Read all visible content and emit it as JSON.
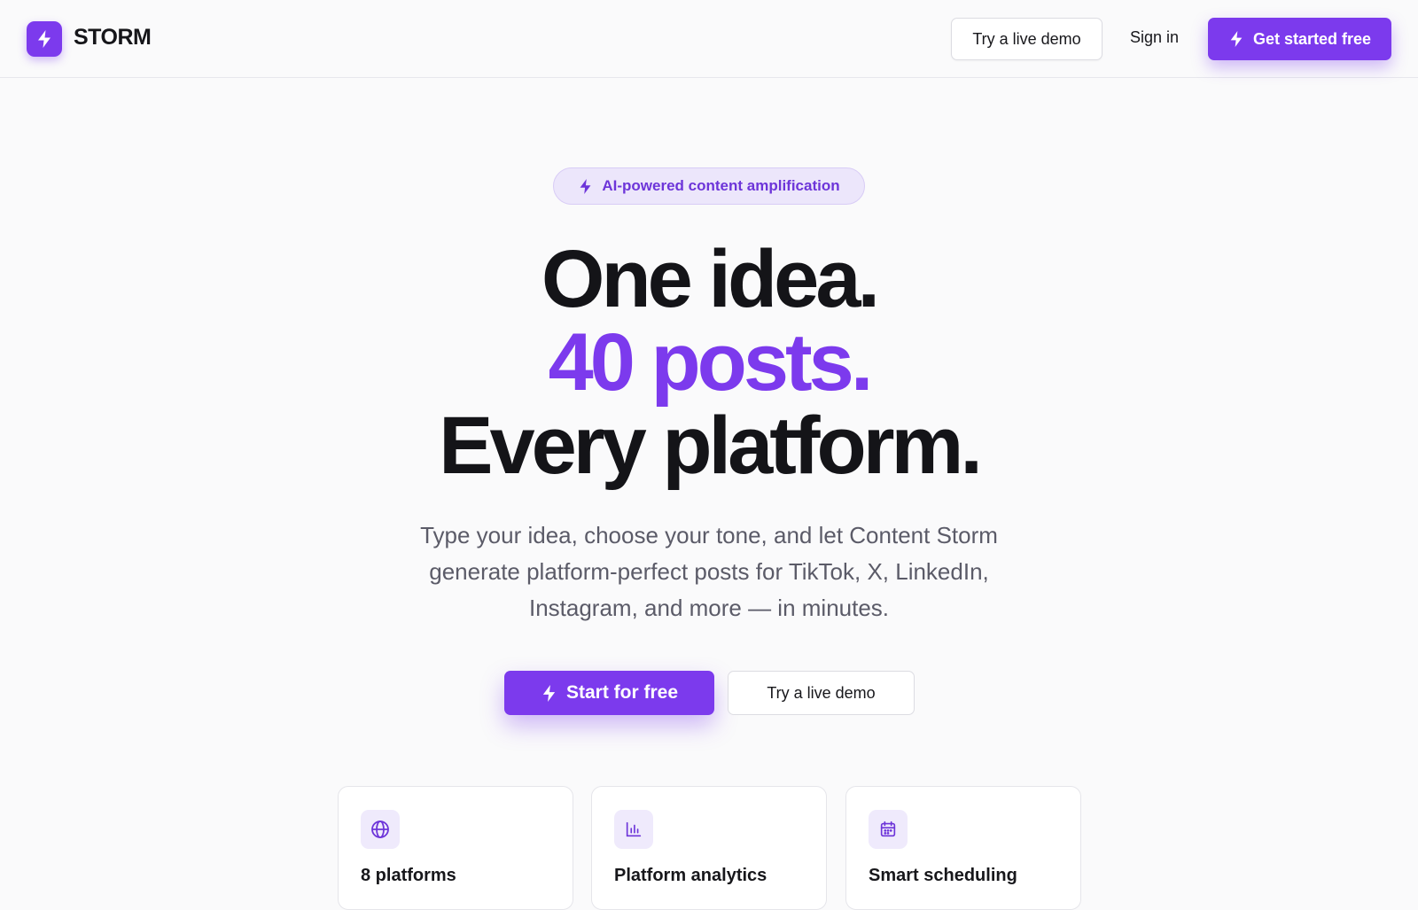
{
  "header": {
    "logo_text": "STORM",
    "logo_icon": "lightning-icon",
    "demo_label": "Try a live demo",
    "signin_label": "Sign in",
    "get_started_label": "Get started free"
  },
  "hero": {
    "badge_text": "AI-powered content amplification",
    "headline_line1": "One idea.",
    "headline_line2": "40 posts.",
    "headline_line3": "Every platform.",
    "subtitle": "Type your idea, choose your tone, and let Content Storm generate platform-perfect posts for TikTok, X, LinkedIn, Instagram, and more — in minutes.",
    "primary_cta": "Start for free",
    "secondary_cta": "Try a live demo"
  },
  "features": [
    {
      "icon": "globe-icon",
      "title": "8 platforms"
    },
    {
      "icon": "bar-chart-icon",
      "title": "Platform analytics"
    },
    {
      "icon": "calendar-icon",
      "title": "Smart scheduling"
    }
  ],
  "colors": {
    "accent": "#7c3aed",
    "background": "#fafafb",
    "text": "#17171b",
    "muted_text": "#5b5b68"
  }
}
